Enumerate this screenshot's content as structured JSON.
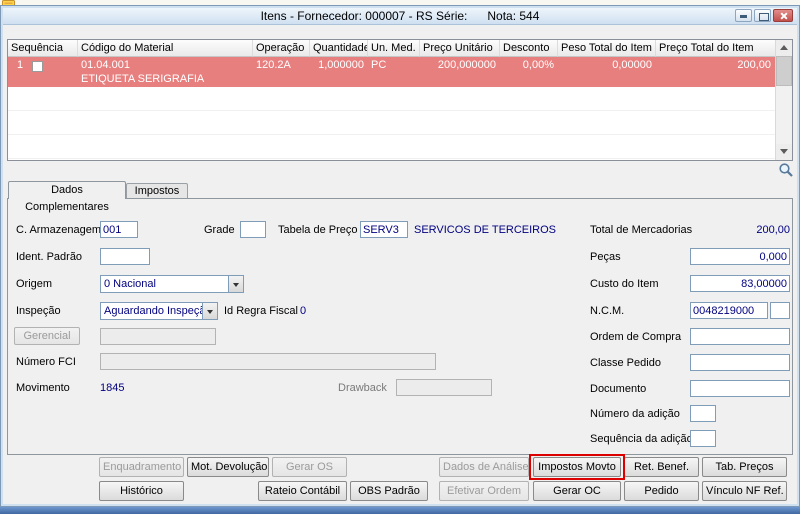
{
  "window": {
    "title": "Itens - Fornecedor: 000007 - RS Série:      Nota: 544"
  },
  "icons": {
    "app_icon": "yellow-document",
    "minimize_icon": "minimize",
    "maximize_icon": "maximize",
    "close_icon": "close",
    "magnifier_icon": "zoom-search",
    "dropdown_icon": "chevron-down",
    "scroll_up_icon": "arrow-up",
    "scroll_down_icon": "arrow-down"
  },
  "colors": {
    "selected_row": "#e87f7f",
    "value_text": "#000080",
    "annotation_highlight": "#dd0000",
    "taskbar": "#3f66a0"
  },
  "grid": {
    "columns": [
      "Sequência",
      "Código do Material",
      "Operação",
      "Quantidade",
      "Un. Med.",
      "Preço Unitário",
      "Desconto",
      "Peso Total do Item",
      "Preço Total do Item"
    ],
    "selected_row": {
      "sequencia": "1",
      "codigo_material": "01.04.001",
      "descricao": "ETIQUETA SERIGRAFIA",
      "operacao": "120.2A",
      "quantidade": "1,000000",
      "un_med": "PC",
      "preco_unitario": "200,000000",
      "desconto": "0,00%",
      "peso_total_item": "0,00000",
      "preco_total_item": "200,00"
    }
  },
  "tabs": {
    "dados_complementares": "Dados Complementares",
    "impostos": "Impostos"
  },
  "form_left": {
    "c_armazenagem": {
      "label": "C. Armazenagem",
      "value": "001"
    },
    "grade": {
      "label": "Grade",
      "value": ""
    },
    "tabela_preco": {
      "label": "Tabela de Preço",
      "value": "SERV3",
      "description": "SERVICOS DE TERCEIROS"
    },
    "ident_padrao": {
      "label": "Ident. Padrão",
      "value": ""
    },
    "origem": {
      "label": "Origem",
      "value": "0 Nacional"
    },
    "inspecao": {
      "label": "Inspeção",
      "value": "Aguardando Inspeção"
    },
    "id_regra_fiscal": {
      "label": "Id Regra Fiscal",
      "value": "0"
    },
    "gerencial": {
      "label": "Gerencial",
      "value": ""
    },
    "numero_fci": {
      "label": "Número FCI",
      "value": ""
    },
    "movimento": {
      "label": "Movimento",
      "value": "1845"
    },
    "drawback": {
      "label": "Drawback",
      "value": ""
    }
  },
  "form_right": {
    "total_mercadorias": {
      "label": "Total de Mercadorias",
      "value": "200,00"
    },
    "pecas": {
      "label": "Peças",
      "value": "0,000"
    },
    "custo_item": {
      "label": "Custo do Item",
      "value": "83,00000"
    },
    "ncm": {
      "label": "N.C.M.",
      "value": "0048219000",
      "extra": ""
    },
    "ordem_compra": {
      "label": "Ordem de Compra",
      "value": ""
    },
    "classe_pedido": {
      "label": "Classe Pedido",
      "value": ""
    },
    "documento": {
      "label": "Documento",
      "value": ""
    },
    "numero_adicao": {
      "label": "Número da adição",
      "value": ""
    },
    "sequencia_adicao": {
      "label": "Sequência da adição",
      "value": ""
    }
  },
  "buttons": {
    "row1": [
      {
        "label": "Enquadramento",
        "disabled": true
      },
      {
        "label": "Mot. Devolução",
        "disabled": false
      },
      {
        "label": "Gerar OS",
        "disabled": true
      },
      {
        "label": "Dados de Análise",
        "disabled": true
      },
      {
        "label": "Impostos Movto",
        "disabled": false,
        "highlighted": true
      },
      {
        "label": "Ret. Benef.",
        "disabled": false
      },
      {
        "label": "Tab. Preços",
        "disabled": false
      }
    ],
    "row2": [
      {
        "label": "Histórico",
        "disabled": false
      },
      {
        "label": "Rateio Contábil",
        "disabled": false
      },
      {
        "label": "OBS Padrão",
        "disabled": false
      },
      {
        "label": "Efetivar Ordem",
        "disabled": true
      },
      {
        "label": "Gerar OC",
        "disabled": false
      },
      {
        "label": "Pedido",
        "disabled": false
      },
      {
        "label": "Vínculo NF Ref.",
        "disabled": false
      }
    ]
  }
}
